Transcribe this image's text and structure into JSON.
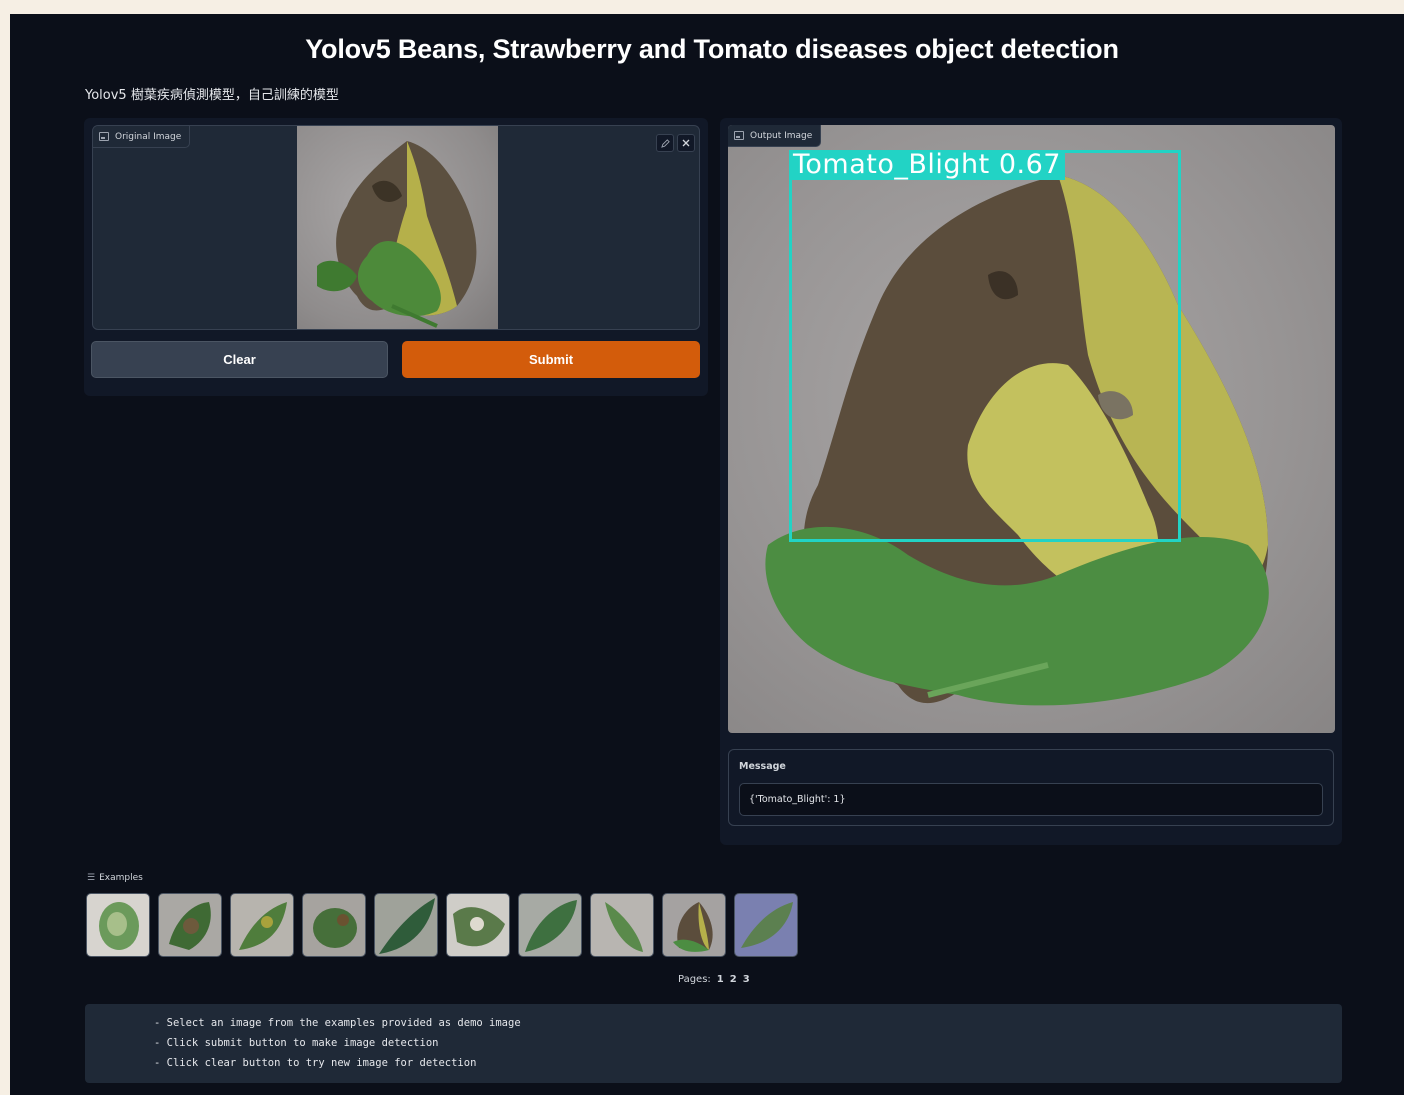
{
  "header": {
    "title": "Yolov5 Beans, Strawberry and Tomato diseases object detection",
    "subtitle": "Yolov5 樹葉疾病偵測模型，自己訓練的模型"
  },
  "input_panel": {
    "label": "Original Image",
    "edit_icon": "pencil-icon",
    "close_icon": "close-icon"
  },
  "buttons": {
    "clear": "Clear",
    "submit": "Submit"
  },
  "output_panel": {
    "label": "Output Image",
    "detection": {
      "class_label": "Tomato_Blight 0.67",
      "box_color": "#22d3c5"
    }
  },
  "message": {
    "label": "Message",
    "value": "{'Tomato_Blight': 1}"
  },
  "examples": {
    "label": "Examples",
    "thumbnails": [
      "example-leaf-1",
      "example-leaf-2",
      "example-leaf-3",
      "example-leaf-4",
      "example-leaf-5",
      "example-leaf-6",
      "example-leaf-7",
      "example-leaf-8",
      "example-leaf-9",
      "example-leaf-10"
    ],
    "pages_label": "Pages:",
    "pages": [
      "1",
      "2",
      "3"
    ]
  },
  "instructions": [
    "- Select an image from the examples provided as demo image",
    "- Click submit button to make image detection",
    "- Click clear button to try new image for detection"
  ],
  "colors": {
    "background": "#0b0f19",
    "panel": "#111827",
    "submit": "#d35c0b",
    "clear": "#374151"
  }
}
